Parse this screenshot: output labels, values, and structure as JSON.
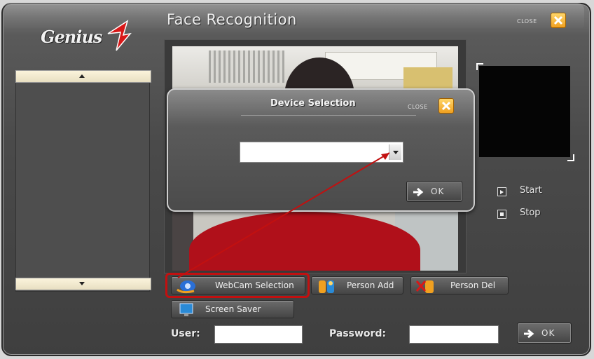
{
  "app": {
    "title": "Face Recognition",
    "logo_text": "Genius",
    "close_label": "CLOSE"
  },
  "controls": {
    "start_label": "Start",
    "stop_label": "Stop"
  },
  "toolbar": {
    "webcam_selection_label": "WebCam Selection",
    "person_add_label": "Person Add",
    "person_del_label": "Person Del",
    "screen_saver_label": "Screen Saver"
  },
  "login": {
    "user_label": "User:",
    "user_value": "",
    "password_label": "Password:",
    "password_value": "",
    "ok_label": "OK"
  },
  "dialog": {
    "title": "Device Selection",
    "close_label": "CLOSE",
    "device_value": "",
    "ok_label": "OK"
  },
  "colors": {
    "accent_close": "#f0a020",
    "highlight_ring": "#c21010",
    "annotation_arrow": "#c21010",
    "logo_swoosh": "#d81818"
  }
}
